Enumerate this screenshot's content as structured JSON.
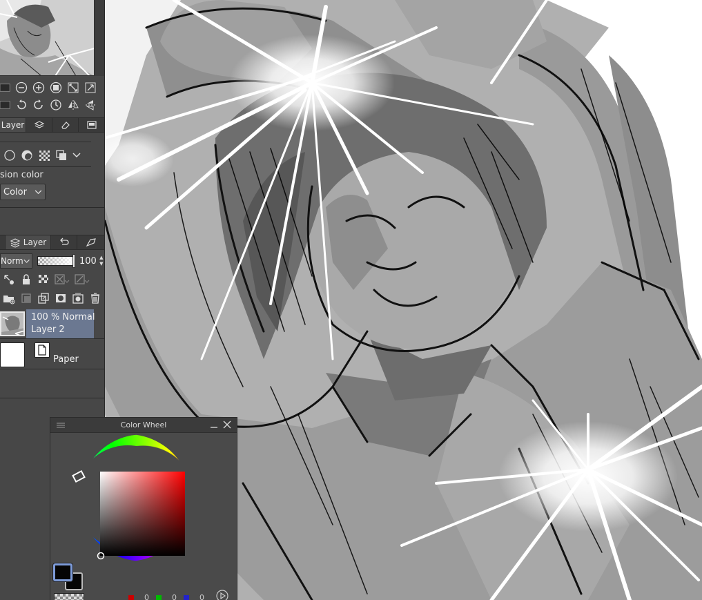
{
  "tool_property": {
    "tabs": [
      "Layer"
    ],
    "expression_color_label": "sion color",
    "expression_color_value": "Color"
  },
  "layer_panel": {
    "tab_label": "Layer",
    "blend_mode": "Norm",
    "opacity": "100",
    "layers": [
      {
        "line1": "100 % Normal",
        "line2": "Layer 2",
        "selected": true
      },
      {
        "line1": "",
        "line2": "Paper",
        "selected": false
      }
    ]
  },
  "color_wheel": {
    "title": "Color Wheel",
    "hue_color": "#ff0000",
    "foreground_color": "#050505",
    "background_color": "#060606",
    "rgb": {
      "r": "0",
      "g": "0",
      "b": "0"
    }
  },
  "icons": [
    "minus-icon",
    "plus-icon",
    "fit-icon",
    "zoom-actual-icon",
    "fit-window-icon",
    "rotate-left-icon",
    "rotate-right-icon",
    "reset-rotation-icon",
    "flip-horizontal-icon",
    "flip-vertical-icon",
    "layer-property-icon",
    "eraser-icon",
    "circle-icon",
    "blend-circles-icon",
    "dither-icon",
    "layer-stack-icon",
    "undo-history-icon",
    "auto-action-icon",
    "lock-icon",
    "new-folder-icon",
    "new-layer-icon",
    "delete-icon"
  ]
}
